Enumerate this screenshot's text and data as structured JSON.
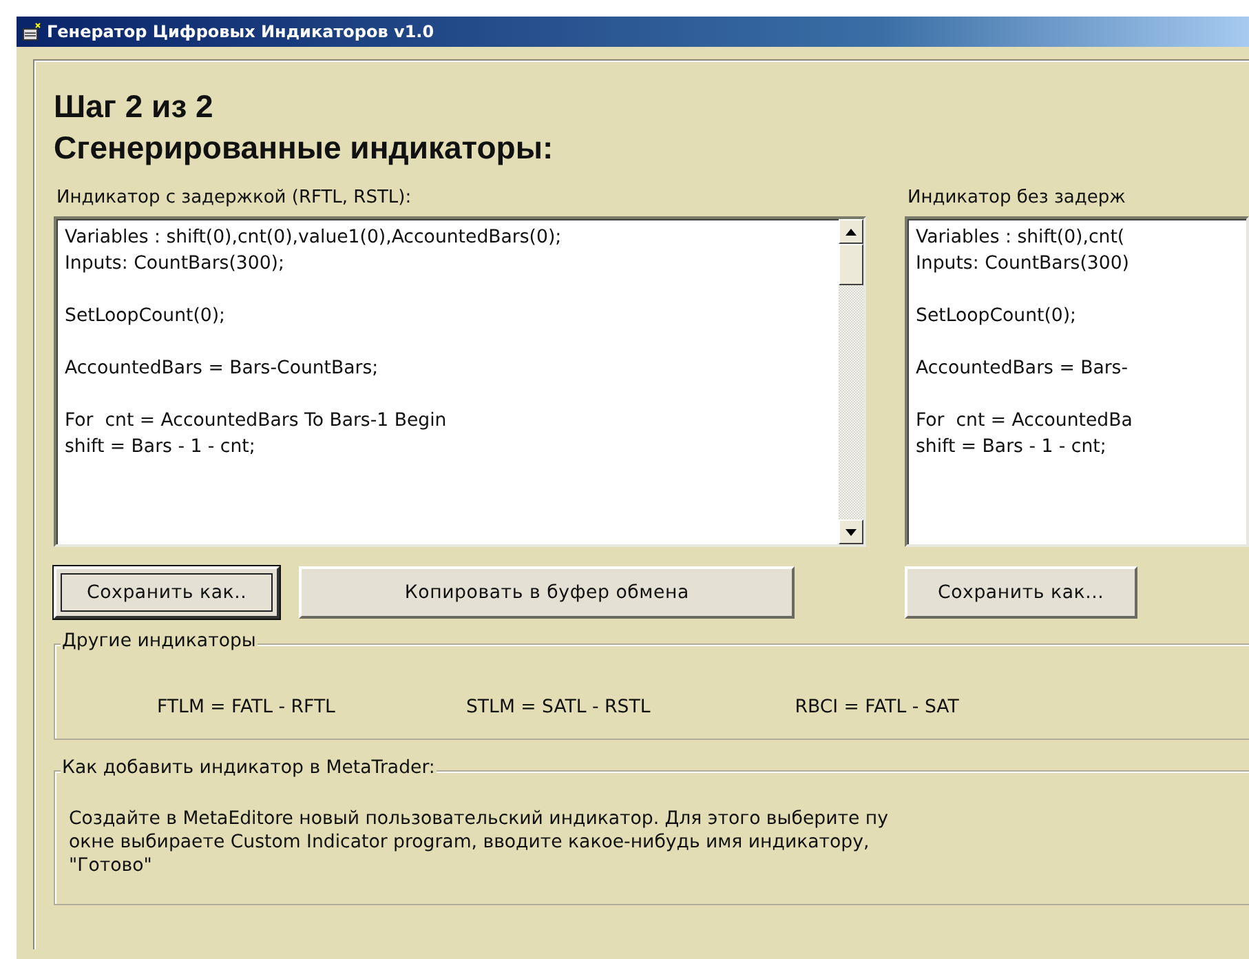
{
  "window": {
    "title": "Генератор Цифровых Индикаторов v1.0"
  },
  "step": "Шаг 2 из 2",
  "heading": "Сгенерированные индикаторы:",
  "panels": [
    {
      "label": "Индикатор с задержкой (RFTL, RSTL):",
      "scrollbar": true,
      "code": [
        [
          "Variables : shift(0),cnt(0),value1(0),AccountedBars(0);",
          "Inputs: CountBars(300);"
        ],
        [
          "SetLoopCount(0);"
        ],
        [
          "AccountedBars = Bars-CountBars;"
        ],
        [
          "For  cnt = AccountedBars To Bars-1 Begin",
          "shift = Bars - 1 - cnt;"
        ]
      ],
      "buttons": [
        {
          "label": "Сохранить как..",
          "focused": true
        },
        {
          "label": "Копировать в буфер обмена",
          "focused": false
        }
      ]
    },
    {
      "label": "Индикатор без задерж",
      "scrollbar": false,
      "code": [
        [
          "Variables : shift(0),cnt(",
          "Inputs: CountBars(300)"
        ],
        [
          "SetLoopCount(0);"
        ],
        [
          "AccountedBars = Bars-"
        ],
        [
          "For  cnt = AccountedBa",
          "shift = Bars - 1 - cnt;"
        ]
      ],
      "buttons": [
        {
          "label": "Сохранить как...",
          "focused": false
        }
      ]
    }
  ],
  "other_indicators": {
    "title": "Другие индикаторы",
    "formulas": [
      "FTLM = FATL - RFTL",
      "STLM = SATL - RSTL",
      "RBCI = FATL - SAT"
    ]
  },
  "how_to": {
    "title": "Как добавить индикатор в MetaTrader:",
    "lines": [
      "Создайте в MetaEditore новый пользовательский индикатор. Для этого выберите пу",
      "окне выбираете Custom Indicator program, вводите какое-нибудь имя индикатору,",
      "\"Готово\""
    ]
  }
}
